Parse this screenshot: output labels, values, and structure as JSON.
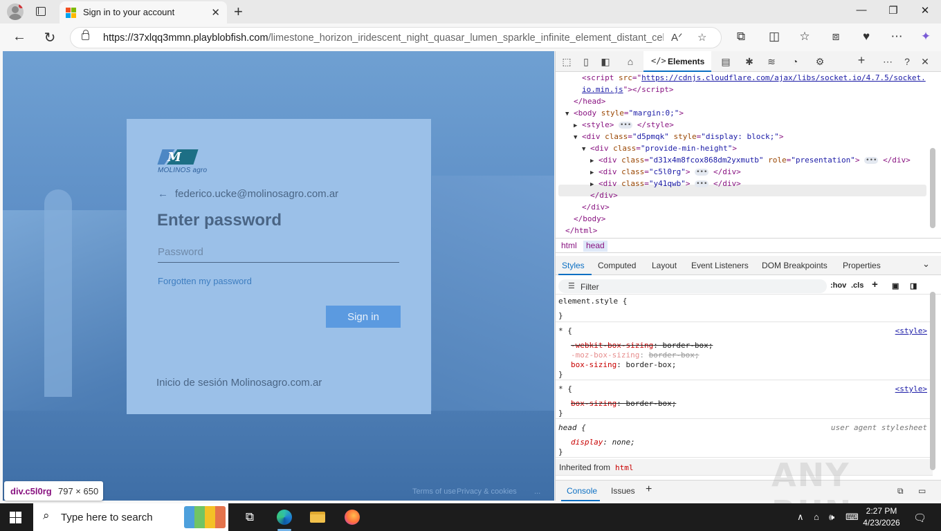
{
  "browser": {
    "tab_title": "Sign in to your account",
    "url_host": "https://37xlqq3mmn.playblobfish.com",
    "url_path": "/limestone_horizon_iridescent_night_quasar_lumen_sparkle_infinite_element_distant_celest...",
    "new_tab_glyph": "+",
    "close_glyph": "✕"
  },
  "page": {
    "logo_mark": "M",
    "logo_text": "MOLINOS agro",
    "identity_email": "federico.ucke@molinosagro.com.ar",
    "title": "Enter password",
    "password_placeholder": "Password",
    "forgot_link": "Forgotten my password",
    "signin_button": "Sign in",
    "footer_text": "Inicio de sesión Molinosagro.com.ar",
    "bottom_links": [
      "Terms of use",
      "Privacy & cookies",
      "..."
    ]
  },
  "inspect_tooltip": {
    "element": "div.c5l0rg",
    "size": "797 × 650"
  },
  "devtools": {
    "active_tab": "Elements",
    "dom": [
      {
        "indent": 0,
        "parts": [
          "<script src=\"",
          "https://cdnjs.cloudflare.com/ajax/libs/socket.io/4.7.5/socket.",
          "\">"
        ]
      },
      {
        "text": "io.min.js"
      },
      {
        "text": "</head>"
      },
      {
        "text": "<body style=\"margin:0;\">"
      },
      {
        "text": "<style> … </style>"
      },
      {
        "text": "<div class=\"d5pmqk\" style=\"display: block;\">"
      },
      {
        "text": "<div class=\"provide-min-height\">"
      },
      {
        "text": "<div class=\"d31x4m8fcox868dm2yxmutb\" role=\"presentation\"> … </div>"
      },
      {
        "text": "<div class=\"c5l0rg\"> … </div>"
      },
      {
        "text": "<div class=\"y41qwb\"> … </div>"
      },
      {
        "text": "</div>"
      },
      {
        "text": "</div>"
      },
      {
        "text": "</body>"
      },
      {
        "text": "</html>"
      }
    ],
    "breadcrumbs": [
      "html",
      "head"
    ],
    "style_tabs": [
      "Styles",
      "Computed",
      "Layout",
      "Event Listeners",
      "DOM Breakpoints",
      "Properties"
    ],
    "filter_placeholder": "Filter",
    "filter_tools": [
      ":hov",
      ".cls"
    ],
    "rules": {
      "element_style": "element.style {",
      "close": "}",
      "universal": "* {",
      "source": "<style>",
      "webkit_prop": "-webkit-box-sizing",
      "moz_prop": "-moz-box-sizing",
      "box_prop": "box-sizing",
      "box_value": "border-box;",
      "head_selector": "head {",
      "ua_label": "user agent stylesheet",
      "display_prop": "display",
      "display_value": "none;"
    },
    "inherited_label": "Inherited from",
    "inherited_tag": "html",
    "drawer_tabs": [
      "Console",
      "Issues"
    ]
  },
  "watermark": "ANY RUN",
  "taskbar": {
    "search_placeholder": "Type here to search",
    "time": "2:27 PM",
    "date": "4/23/2026"
  }
}
